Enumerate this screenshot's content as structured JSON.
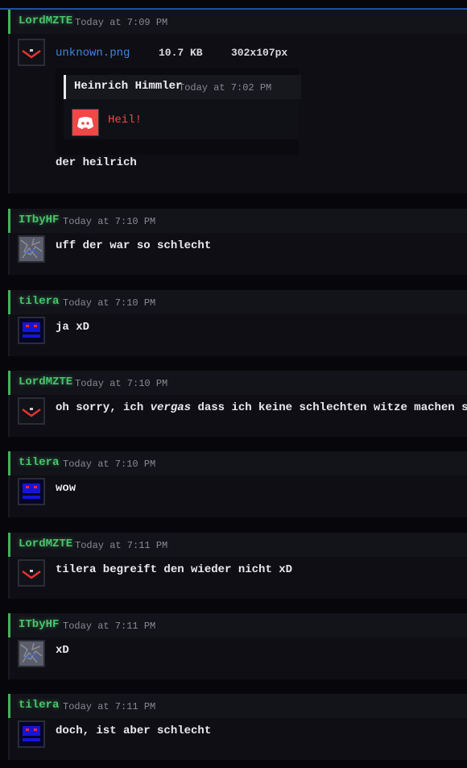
{
  "messages": [
    {
      "author": "LordMZTE",
      "time": "Today at 7:09 PM",
      "avatar": "chevron-avatar",
      "text": "der heilrich",
      "attachment": {
        "filename": "unknown.png",
        "size": "10.7 KB",
        "dimensions": "302x107px",
        "embed": {
          "author": "Heinrich Himmler",
          "time": "Today at 7:02 PM",
          "avatar": "discord-avatar",
          "text": "Heil!"
        }
      }
    },
    {
      "author": "ITbyHF",
      "time": "Today at 7:10 PM",
      "avatar": "noise-avatar",
      "text": "uff der war so schlecht"
    },
    {
      "author": "tilera",
      "time": "Today at 7:10 PM",
      "avatar": "blue-block-avatar",
      "text": "ja xD"
    },
    {
      "author": "LordMZTE",
      "time": "Today at 7:10 PM",
      "avatar": "chevron-avatar",
      "text_before": "oh sorry, ich ",
      "text_em": "vergas",
      "text_after": " dass ich keine schlechten witze machen soll"
    },
    {
      "author": "tilera",
      "time": "Today at 7:10 PM",
      "avatar": "blue-block-avatar",
      "text": "wow"
    },
    {
      "author": "LordMZTE",
      "time": "Today at 7:11 PM",
      "avatar": "chevron-avatar",
      "text": "tilera begreift den wieder nicht xD"
    },
    {
      "author": "ITbyHF",
      "time": "Today at 7:11 PM",
      "avatar": "noise-avatar",
      "text": "xD"
    },
    {
      "author": "tilera",
      "time": "Today at 7:11 PM",
      "avatar": "blue-block-avatar",
      "text": "doch, ist aber schlecht"
    }
  ],
  "colors": {
    "accent": "#3fb45a",
    "link": "#3e84e0",
    "embed_text": "#f04747",
    "topline": "#1f4fa8"
  }
}
